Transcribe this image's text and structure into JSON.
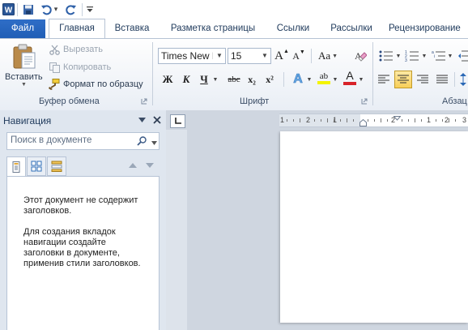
{
  "qat": {
    "undo_menu": "▾",
    "customize": "▾"
  },
  "tabs": [
    "Файл",
    "Главная",
    "Вставка",
    "Разметка страницы",
    "Ссылки",
    "Рассылки",
    "Рецензирование"
  ],
  "clipboard": {
    "paste": "Вставить",
    "cut": "Вырезать",
    "copy": "Копировать",
    "format_painter": "Формат по образцу",
    "group_label": "Буфер обмена"
  },
  "font": {
    "font_name": "Times New Ro",
    "font_size": "15",
    "group_label": "Шрифт",
    "bold": "Ж",
    "italic": "К",
    "underline": "Ч",
    "strike": "abc",
    "subscript": "x₂",
    "superscript": "x²",
    "grow": "A",
    "shrink": "A",
    "change_case": "Aa",
    "text_effects": "A",
    "highlight": "ab",
    "font_color": "A"
  },
  "paragraph": {
    "group_label": "Абзац"
  },
  "nav": {
    "title": "Навигация",
    "search_placeholder": "Поиск в документе",
    "msg1": "Этот документ не содержит заголовков.",
    "msg2": "Для создания вкладок навигации создайте заголовки в документе, применив стили заголовков."
  },
  "ruler": {
    "labels": [
      "1",
      "2",
      "1",
      "2",
      "1",
      "2",
      "3"
    ]
  },
  "colors": {
    "accent": "#2b579a",
    "file_tab": "#2a65c0",
    "font_color_bar": "#d8232a",
    "highlight_bar": "#f4f400"
  }
}
